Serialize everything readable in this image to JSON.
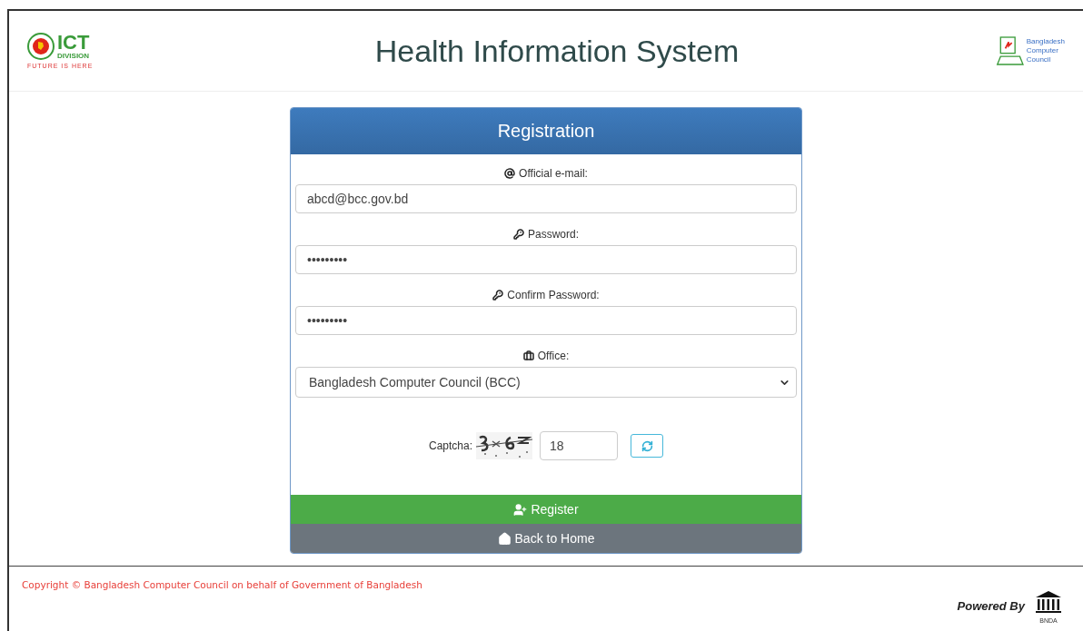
{
  "header": {
    "left_logo": {
      "title": "ICT",
      "subtitle": "DIVISION",
      "tagline": "FUTURE IS HERE"
    },
    "title": "Health Information System",
    "right_logo": {
      "lines": [
        "Bangladesh",
        "Computer",
        "Council"
      ]
    }
  },
  "form": {
    "title": "Registration",
    "fields": [
      {
        "kind": "email",
        "label": "Official e-mail:",
        "value": "abcd@bcc.gov.bd"
      },
      {
        "kind": "password",
        "label": "Password:",
        "value": "•••••••••"
      },
      {
        "kind": "password",
        "label": "Confirm Password:",
        "value": "•••••••••"
      },
      {
        "kind": "select",
        "label": "Office:",
        "value": "Bangladesh Computer Council (BCC)"
      }
    ],
    "captcha": {
      "label": "Captcha:",
      "value": "18"
    },
    "buttons": [
      {
        "kind": "register",
        "label": "Register"
      },
      {
        "kind": "home",
        "label": "Back to Home"
      }
    ]
  },
  "footer": {
    "copyright": "Copyright © Bangladesh Computer Council on behalf of Government of Bangladesh",
    "powered_by": "Powered By",
    "powered_logo_text": "BNDA"
  }
}
